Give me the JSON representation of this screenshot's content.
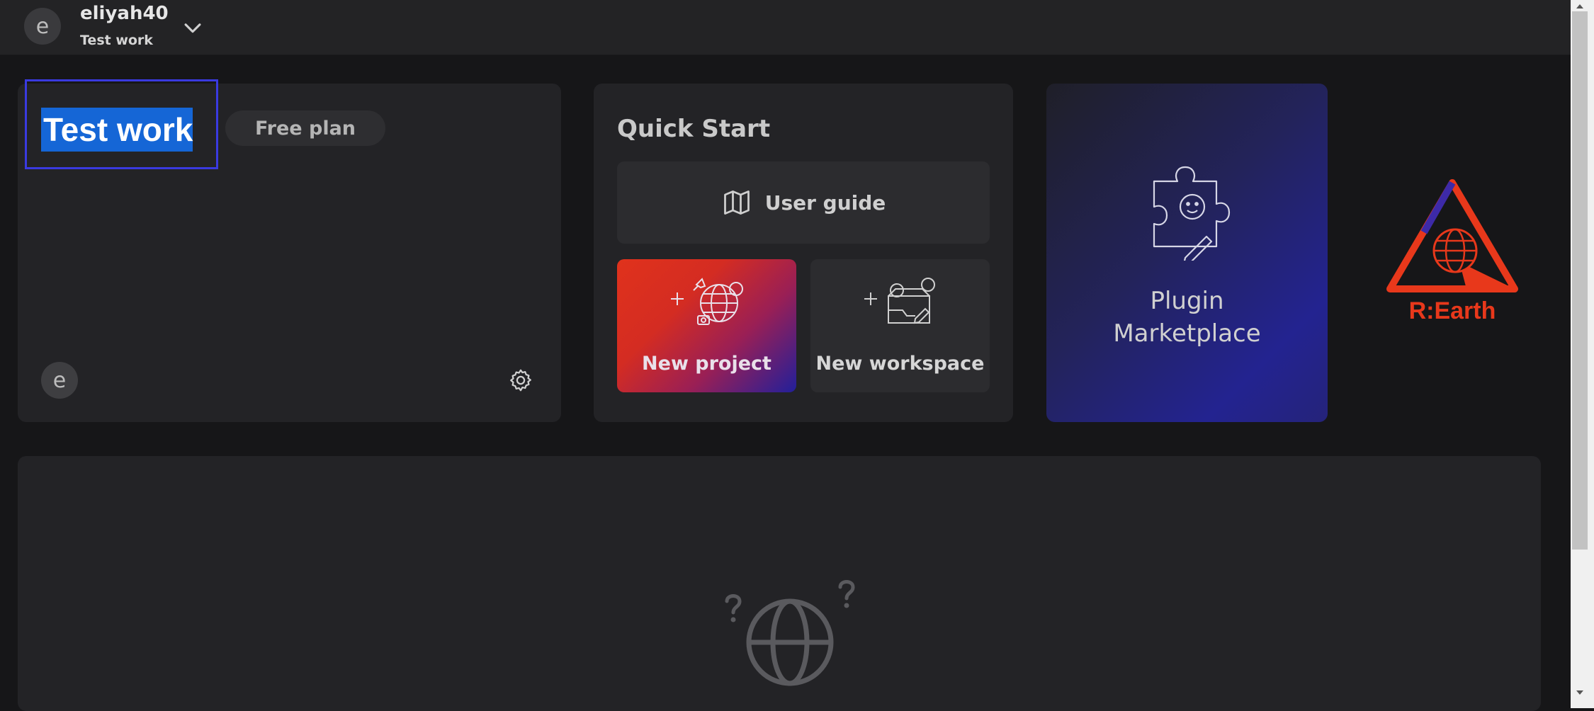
{
  "header": {
    "avatar_letter": "e",
    "username": "eliyah40",
    "workspace_name": "Test work",
    "dropdown_icon": "chevron-down-icon"
  },
  "workspace_card": {
    "title": "Test work",
    "plan_label": "Free plan",
    "member_avatar_letter": "e",
    "settings_icon": "gear-icon"
  },
  "quick_start": {
    "title": "Quick Start",
    "user_guide_label": "User guide",
    "user_guide_icon": "map-icon",
    "new_project_label": "New project",
    "new_project_icon": "globe-rocket-plus-icon",
    "new_workspace_label": "New workspace",
    "new_workspace_icon": "workspace-plus-icon"
  },
  "plugin_card": {
    "label_line1": "Plugin",
    "label_line2": "Marketplace",
    "icon": "puzzle-piece-icon"
  },
  "logo": {
    "text": "R:Earth",
    "icon": "reearth-logo"
  },
  "projects_panel": {
    "empty_icon": "globe-question-icon"
  },
  "colors": {
    "background": "#161618",
    "card": "#232326",
    "selection": "#1566d6",
    "focus_outline": "#3a3ae0",
    "brand_red": "#e8381b",
    "plugin_gradient_end": "#232390"
  }
}
